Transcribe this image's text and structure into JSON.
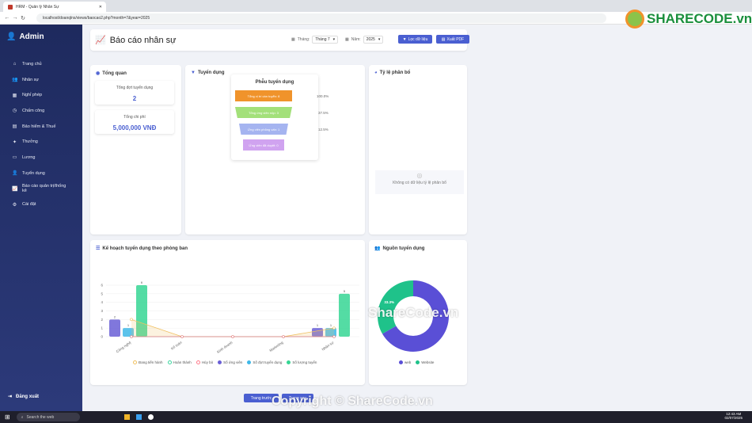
{
  "browser": {
    "tab_title": "HRM - Quản lý Nhân Sự",
    "url": "localhost/doanqlns/views/baocao2.php?month=7&year=2025"
  },
  "sidebar": {
    "brand": "Admin",
    "items": [
      {
        "label": "Trang chủ",
        "icon": "home-icon"
      },
      {
        "label": "Nhân sự",
        "icon": "users-icon"
      },
      {
        "label": "Nghỉ phép",
        "icon": "calendar-icon"
      },
      {
        "label": "Chấm công",
        "icon": "clock-icon"
      },
      {
        "label": "Bảo hiểm & Thuế",
        "icon": "money-icon"
      },
      {
        "label": "Thưởng",
        "icon": "gift-icon"
      },
      {
        "label": "Lương",
        "icon": "wallet-icon"
      },
      {
        "label": "Tuyển dụng",
        "icon": "user-plus-icon"
      },
      {
        "label": "Báo cáo quản trị/thống kê",
        "icon": "chart-icon"
      },
      {
        "label": "Cài đặt",
        "icon": "gear-icon"
      }
    ],
    "logout": "Đăng xuất"
  },
  "header": {
    "title": "Báo cáo nhân sự",
    "month_label": "Tháng:",
    "month_value": "Tháng 7",
    "year_label": "Năm:",
    "year_value": "2025",
    "filter_button": "Lọc dữ liệu",
    "export_button": "Xuất PDF"
  },
  "overview": {
    "title": "Tổng quan",
    "stats": [
      {
        "label": "Tổng đợt tuyển dụng",
        "value": "2"
      },
      {
        "label": "Tổng chi phí",
        "value": "5,000,000 VNĐ"
      }
    ]
  },
  "recruitment": {
    "title": "Tuyển dụng",
    "funnel_title": "Phễu tuyển dụng",
    "stages": [
      {
        "label": "Tổng vị trí cần tuyển: 8",
        "pct": "100.0%",
        "color": "#f0932b"
      },
      {
        "label": "Tổng ứng viên nộp: 3",
        "pct": "37.5%",
        "color": "#a3e07a"
      },
      {
        "label": "Ứng viên phỏng vấn: 1",
        "pct": "12.5%",
        "color": "#a5b4f0"
      },
      {
        "label": "Ứng viên đã duyệt: 0",
        "pct": "",
        "color": "#d0a3f0"
      }
    ]
  },
  "distribution": {
    "title": "Tỷ lệ phân bổ",
    "empty_text": "Không có dữ liệu tỷ lệ phân bổ"
  },
  "plan": {
    "title": "Kế hoạch tuyển dụng theo phòng ban"
  },
  "sources": {
    "title": "Nguồn tuyển dụng"
  },
  "chart_data": [
    {
      "type": "bar",
      "title": "Kế hoạch tuyển dụng theo phòng ban",
      "categories": [
        "Công nghệ",
        "Kế toán",
        "Kinh doanh",
        "Marketing",
        "Nhân sự"
      ],
      "ylim": [
        0,
        6
      ],
      "yticks": [
        0,
        1,
        2,
        3,
        4,
        5,
        6
      ],
      "series": [
        {
          "name": "Đang tiến hành",
          "type": "line",
          "color": "#f0c060",
          "values": [
            2,
            0,
            0,
            0,
            1
          ]
        },
        {
          "name": "Hoàn thành",
          "type": "line",
          "color": "#3dd6a0",
          "values": [
            0,
            0,
            0,
            0,
            0
          ]
        },
        {
          "name": "Hủy bỏ",
          "type": "line",
          "color": "#ff7a8a",
          "values": [
            0,
            0,
            0,
            0,
            0
          ]
        },
        {
          "name": "Số ứng viên",
          "type": "bar",
          "color": "#6a5fd6",
          "values": [
            2,
            0,
            0,
            0,
            1
          ]
        },
        {
          "name": "Số đợt tuyển dụng",
          "type": "bar",
          "color": "#3fb8e8",
          "values": [
            1,
            0,
            0,
            0,
            1
          ]
        },
        {
          "name": "Số lượng tuyển",
          "type": "bar",
          "color": "#36d694",
          "values": [
            6,
            0,
            0,
            0,
            5
          ]
        }
      ]
    },
    {
      "type": "pie",
      "title": "Nguồn tuyển dụng",
      "categories": [
        "web",
        "Website"
      ],
      "values": [
        66.7,
        33.3
      ],
      "labels": [
        "",
        "33.3%"
      ],
      "colors": [
        "#5a4fd6",
        "#1fc28a"
      ]
    }
  ],
  "pagination": {
    "prev": "Trang trước",
    "next": "Trang sau"
  },
  "taskbar": {
    "search": "Search the web",
    "time": "12:43 AM",
    "date": "02/07/2025"
  },
  "watermarks": {
    "logo": "SHARECODE.vn",
    "center": "ShareCode.vn",
    "footer": "Copyright © ShareCode.vn"
  }
}
